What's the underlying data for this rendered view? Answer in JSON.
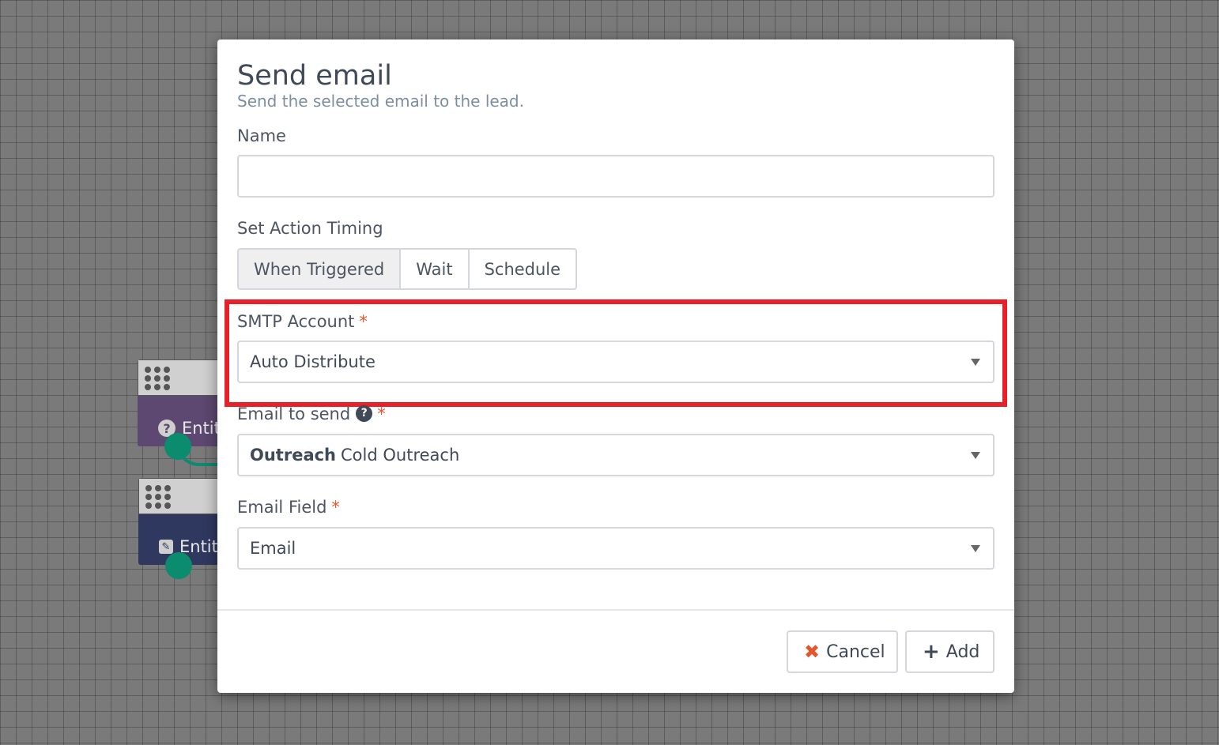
{
  "canvas": {
    "nodes": [
      {
        "label": "Entit",
        "icon": "question-icon"
      },
      {
        "label": "Entit",
        "icon": "edit-icon"
      }
    ]
  },
  "modal": {
    "title": "Send email",
    "subtitle": "Send the selected email to the lead.",
    "name_field": {
      "label": "Name",
      "value": "",
      "placeholder": ""
    },
    "timing": {
      "label": "Set Action Timing",
      "options": [
        "When Triggered",
        "Wait",
        "Schedule"
      ],
      "selected": "When Triggered"
    },
    "smtp": {
      "label": "SMTP Account",
      "required_mark": "*",
      "value": "Auto Distribute"
    },
    "email_to_send": {
      "label": "Email to send",
      "required_mark": "*",
      "value_bold": "Outreach",
      "value": "Cold Outreach",
      "help_icon": "question-circle-icon"
    },
    "email_field": {
      "label": "Email Field",
      "required_mark": "*",
      "value": "Email"
    },
    "buttons": {
      "cancel": "Cancel",
      "add": "Add"
    }
  },
  "colors": {
    "highlight": "#e8202a",
    "required": "#e4572e",
    "node_purple": "#5c4870",
    "node_navy": "#2f3960",
    "connector": "#0b8c6e"
  }
}
